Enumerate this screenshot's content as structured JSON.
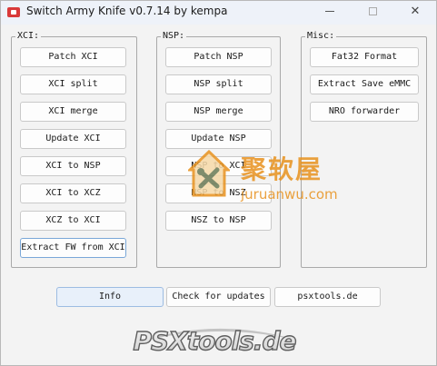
{
  "window": {
    "title": "Switch Army Knife v0.7.14 by kempa",
    "icons": {
      "app": "switch-app-icon",
      "minimize": "minimize-icon",
      "maximize": "maximize-icon",
      "close": "close-icon"
    },
    "close_glyph": "✕"
  },
  "groups": {
    "xci": {
      "legend": "XCI:",
      "buttons": [
        "Patch XCI",
        "XCI split",
        "XCI merge",
        "Update XCI",
        "XCI to NSP",
        "XCI to XCZ",
        "XCZ to XCI",
        "Extract FW from XCI"
      ]
    },
    "nsp": {
      "legend": "NSP:",
      "buttons": [
        "Patch NSP",
        "NSP split",
        "NSP merge",
        "Update NSP",
        "NSP to XCI",
        "NSP to NSZ",
        "NSZ to NSP"
      ]
    },
    "misc": {
      "legend": "Misc:",
      "buttons": [
        "Fat32 Format",
        "Extract Save eMMC",
        "NRO forwarder"
      ]
    }
  },
  "bottom": {
    "info": "Info",
    "check_updates": "Check for updates",
    "site": "psxtools.de"
  },
  "logo": {
    "text": "PSXtools.de",
    "icon": "psxtools-logo"
  },
  "watermark": {
    "text_cn": "聚软屋",
    "text_en": "juruanwu.com",
    "icon": "house-tools-watermark-icon"
  },
  "colors": {
    "accent": "#7aa7d8",
    "watermark": "#e8921e",
    "logo_fill": "#e6e6e6",
    "logo_stroke": "#6d6d6d"
  }
}
